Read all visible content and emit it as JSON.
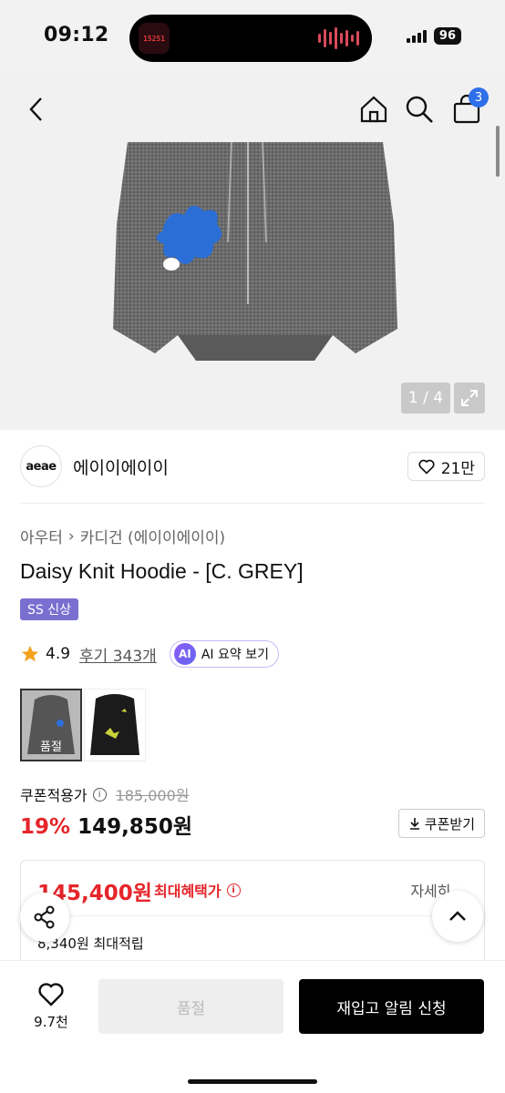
{
  "status_bar": {
    "time": "09:12",
    "island_thumb_text": "15251",
    "battery": "96"
  },
  "header": {
    "cart_count": "3",
    "icons": [
      "back-icon",
      "home-icon",
      "search-icon",
      "cart-icon"
    ]
  },
  "gallery": {
    "counter": "1 / 4"
  },
  "brand": {
    "logo_text": "aeae",
    "name": "에이이에이이",
    "likes": "21만"
  },
  "product": {
    "breadcrumb": [
      "아우터",
      "카디건 (에이이에이이)"
    ],
    "title": "Daisy Knit Hoodie - [C. GREY]",
    "tag": "SS 신상",
    "rating": "4.9",
    "reviews": "후기 343개",
    "ai_button": "AI 요약 보기",
    "ai_badge": "AI",
    "thumb_sold_label": "품절"
  },
  "pricing": {
    "coupon_label": "쿠폰적용가",
    "original_price": "185,000원",
    "discount": "19%",
    "price": "149,850원",
    "coupon_button": "쿠폰받기"
  },
  "benefit": {
    "max_price": "145,400원",
    "max_label": "최대혜택가",
    "detail": "자세히",
    "points": "8,340원 최대적립"
  },
  "bottom_bar": {
    "like_count": "9.7천",
    "sold_out": "품절",
    "restock": "재입고 알림 신청"
  },
  "colors": {
    "accent_red": "#e5252a",
    "tag_purple": "#7a6fd0",
    "badge_blue": "#2f6fe8"
  }
}
